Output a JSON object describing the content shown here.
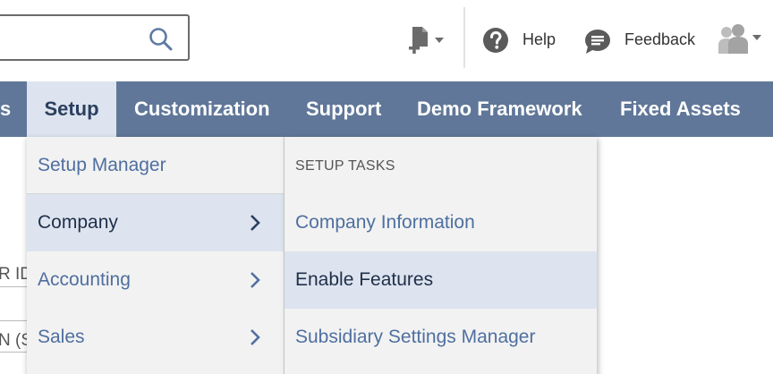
{
  "header": {
    "search": {
      "value": "",
      "placeholder": ""
    },
    "icons": {
      "search": "search-icon",
      "create": "create-new-icon",
      "help": "help-icon",
      "feedback": "feedback-icon",
      "roles": "user-roles-icon"
    },
    "help_label": "Help",
    "feedback_label": "Feedback"
  },
  "nav": {
    "items": [
      {
        "label": "s",
        "active": false
      },
      {
        "label": "Setup",
        "active": true
      },
      {
        "label": "Customization",
        "active": false
      },
      {
        "label": "Support",
        "active": false
      },
      {
        "label": "Demo Framework",
        "active": false
      },
      {
        "label": "Fixed Assets",
        "active": false
      }
    ]
  },
  "background_fragments": [
    "R ID",
    "N (S"
  ],
  "menu": {
    "primary": [
      {
        "label": "Setup Manager",
        "has_submenu": false,
        "highlighted": false
      },
      {
        "label": "Company",
        "has_submenu": true,
        "highlighted": true
      },
      {
        "label": "Accounting",
        "has_submenu": true,
        "highlighted": false
      },
      {
        "label": "Sales",
        "has_submenu": true,
        "highlighted": false
      }
    ],
    "submenu": {
      "heading": "SETUP TASKS",
      "items": [
        {
          "label": "Company Information",
          "highlighted": false
        },
        {
          "label": "Enable Features",
          "highlighted": true
        },
        {
          "label": "Subsidiary Settings Manager",
          "highlighted": false
        }
      ]
    }
  },
  "colors": {
    "nav_bg": "#607799",
    "nav_active_bg": "#dde4ef",
    "menu_bg": "#f2f2f2",
    "menu_highlight": "#dde4ef",
    "link_text": "#4f6fa0"
  }
}
